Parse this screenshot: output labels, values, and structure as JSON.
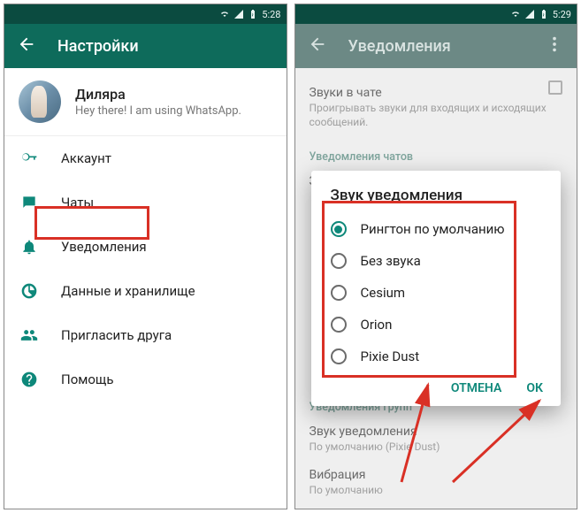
{
  "statusbar": {
    "time_left": "5:28",
    "time_right": "5:29"
  },
  "left": {
    "appbar_title": "Настройки",
    "profile": {
      "name": "Диляра",
      "status": "Hey there! I am using WhatsApp."
    },
    "menu": {
      "account": "Аккаунт",
      "chats": "Чаты",
      "notifications": "Уведомления",
      "data": "Данные и хранилище",
      "invite": "Пригласить друга",
      "help": "Помощь"
    }
  },
  "right": {
    "appbar_title": "Уведомления",
    "chat_sounds": {
      "title": "Звуки в чате",
      "sub": "Проигрывать звуки для входящих и исходящих сообщений."
    },
    "section_chats": "Уведомления чатов",
    "sound_row_title_cut": "Звук уведомления",
    "dialog": {
      "title": "Звук уведомления",
      "options": {
        "default": "Рингтон по умолчанию",
        "silent": "Без звука",
        "cesium": "Cesium",
        "orion": "Orion",
        "pixie": "Pixie Dust"
      },
      "cancel": "ОТМЕНА",
      "ok": "ОК"
    },
    "section_groups": "Уведомления групп",
    "group_sound": {
      "title": "Звук уведомления",
      "sub": "По умолчанию (Pixie Dust)"
    },
    "vibration": {
      "title": "Вибрация",
      "sub": "По умолчанию"
    }
  }
}
